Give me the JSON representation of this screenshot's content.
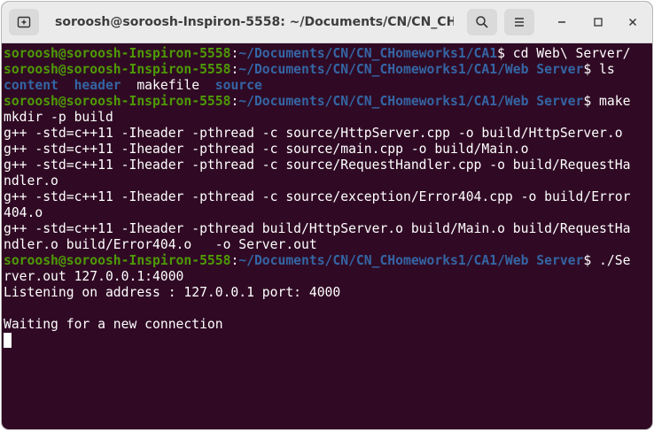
{
  "window": {
    "title": "soroosh@soroosh-Inspiron-5558: ~/Documents/CN/CN_CHo..."
  },
  "prompt": {
    "user": "soroosh@soroosh-Inspiron-5558",
    "path1": "~/Documents/CN/CN_CHomeworks1/CA1",
    "path2": "~/Documents/CN/CN_CHomeworks1/CA1/Web Server"
  },
  "lines": {
    "cmd1": "cd Web\\ Server/",
    "cmd2": "ls",
    "ls_dir1": "content",
    "ls_dir2": "header",
    "ls_file": "makefile",
    "ls_dir3": "source",
    "cmd3": "make",
    "o1": "mkdir -p build",
    "o2": "g++ -std=c++11 -Iheader -pthread -c source/HttpServer.cpp -o build/HttpServer.o",
    "o3": "g++ -std=c++11 -Iheader -pthread -c source/main.cpp -o build/Main.o",
    "o4a": "g++ -std=c++11 -Iheader -pthread -c source/RequestHandler.cpp -o build/RequestHa",
    "o4b": "ndler.o",
    "o5a": "g++ -std=c++11 -Iheader -pthread -c source/exception/Error404.cpp -o build/Error",
    "o5b": "404.o",
    "o6a": "g++ -std=c++11 -Iheader -pthread build/HttpServer.o build/Main.o build/RequestHa",
    "o6b": "ndler.o build/Error404.o   -o Server.out",
    "cmd4a": "./Se",
    "cmd4b": "rver.out 127.0.0.1:4000",
    "o7": "Listening on address : 127.0.0.1 port: 4000",
    "o8": "Waiting for a new connection"
  }
}
